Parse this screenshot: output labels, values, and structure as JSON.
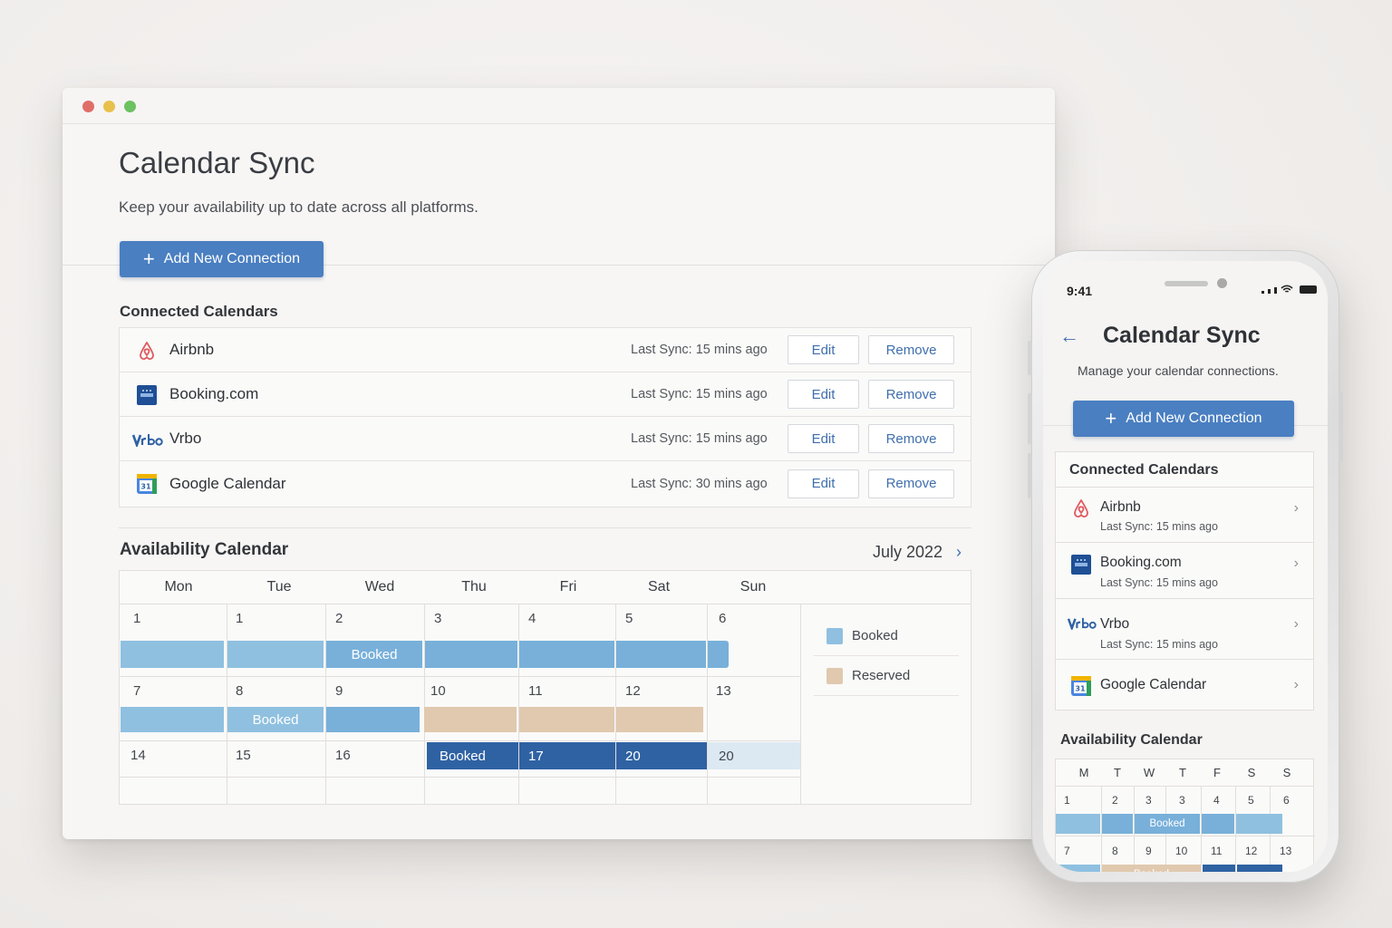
{
  "desktop": {
    "title": "Calendar Sync",
    "subtitle": "Keep your availability up to date across all platforms.",
    "add_button": "Add New Connection",
    "connected_label": "Connected Calendars",
    "connections": [
      {
        "name": "Airbnb",
        "sync": "Last Sync: 15 mins ago",
        "icon": "airbnb-icon"
      },
      {
        "name": "Booking.com",
        "sync": "Last Sync: 15 mins ago",
        "icon": "booking-icon"
      },
      {
        "name": "Vrbo",
        "sync": "Last Sync: 15 mins ago",
        "icon": "vrbo-icon"
      },
      {
        "name": "Google Calendar",
        "sync": "Last Sync: 30 mins ago",
        "icon": "google-calendar-icon"
      }
    ],
    "edit_label": "Edit",
    "remove_label": "Remove",
    "availability_label": "Availability Calendar",
    "month": "July 2022",
    "weekdays": [
      "Mon",
      "Tue",
      "Wed",
      "Thu",
      "Fri",
      "Sat",
      "Sun"
    ],
    "weeks": [
      [
        "1",
        "1",
        "2",
        "3",
        "4",
        "5",
        "6"
      ],
      [
        "7",
        "8",
        "9",
        "10",
        "11",
        "12",
        "13"
      ],
      [
        "14",
        "15",
        "16",
        "",
        "17",
        "20",
        "20"
      ]
    ],
    "booked_label": "Booked",
    "legend": [
      {
        "label": "Booked",
        "color": "#8fc0e0"
      },
      {
        "label": "Reserved",
        "color": "#e0c9ae"
      }
    ]
  },
  "mobile": {
    "time": "9:41",
    "title": "Calendar Sync",
    "subtitle": "Manage your calendar connections.",
    "add_button": "Add New Connection",
    "connected_label": "Connected Calendars",
    "connections": [
      {
        "name": "Airbnb",
        "sync": "Last Sync: 15 mins ago"
      },
      {
        "name": "Booking.com",
        "sync": "Last Sync: 15 mins ago"
      },
      {
        "name": "Vrbo",
        "sync": "Last Sync: 15 mins ago"
      },
      {
        "name": "Google Calendar",
        "sync": ""
      }
    ],
    "availability_label": "Availability Calendar",
    "weekdays": [
      "M",
      "T",
      "W",
      "T",
      "F",
      "S",
      "S"
    ],
    "weeks": [
      [
        "1",
        "2",
        "3",
        "3",
        "4",
        "5",
        "6"
      ],
      [
        "7",
        "8",
        "9",
        "10",
        "11",
        "12",
        "13"
      ]
    ],
    "booked_label": "Booked",
    "booked_label_2": "Booked"
  },
  "colors": {
    "accent": "#4a7fc1",
    "booked_light": "#8fc0e0",
    "booked_dark": "#2f62a3",
    "reserved": "#e0c9ae"
  }
}
